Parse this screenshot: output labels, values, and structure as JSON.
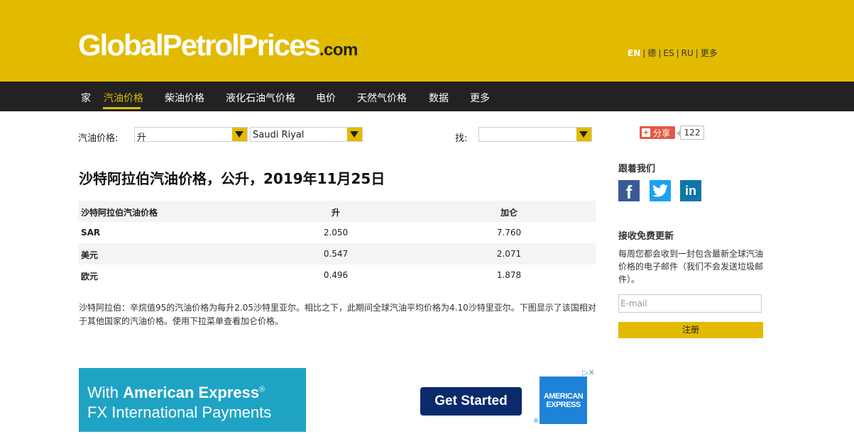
{
  "header": {
    "logo_main": "GlobalPetrolPrices",
    "logo_suffix": ".com",
    "languages": [
      "EN",
      "德",
      "ES",
      "RU",
      "更多"
    ],
    "lang_separator": "|"
  },
  "nav": {
    "items": [
      "家",
      "汽油价格",
      "柴油价格",
      "液化石油气价格",
      "电价",
      "天然气价格",
      "数据",
      "更多"
    ],
    "active": "汽油价格"
  },
  "filters": {
    "label": "汽油价格:",
    "unit_value": "升",
    "currency_value": "Saudi Riyal",
    "find_label": "找:",
    "find_value": ""
  },
  "share": {
    "button_label": "分享",
    "count": "122"
  },
  "main": {
    "title": "沙特阿拉伯汽油价格，公升，2019年11月25日",
    "table": {
      "headers": [
        "沙特阿拉伯汽油价格",
        "升",
        "加仑"
      ],
      "rows": [
        [
          "SAR",
          "2.050",
          "7.760"
        ],
        [
          "美元",
          "0.547",
          "2.071"
        ],
        [
          "欧元",
          "0.496",
          "1.878"
        ]
      ]
    },
    "description": "沙特阿拉伯：辛烷值95的汽油价格为每升2.05沙特里亚尔。相比之下，此期间全球汽油平均价格为4.10沙特里亚尔。下图显示了该国相对于其他国家的汽油价格。使用下拉菜单查看加仑价格。"
  },
  "ad": {
    "line1_prefix": "With ",
    "line1_brand": "American Express",
    "line1_reg": "®",
    "line2": "FX International Payments",
    "cta": "Get Started",
    "logo_line1": "AMERICAN",
    "logo_line2": "EXPRESS",
    "logo_reg": "®",
    "adchoices": "▷✕"
  },
  "sidebar": {
    "follow_heading": "跟着我们",
    "social": [
      "facebook-icon",
      "twitter-icon",
      "linkedin-icon"
    ],
    "updates_heading": "接收免费更新",
    "updates_text": "每周您都会收到一封包含最新全球汽油价格的电子邮件（我们不会发送垃圾邮件）。",
    "email_placeholder": "E-mail",
    "signup_label": "注册"
  }
}
